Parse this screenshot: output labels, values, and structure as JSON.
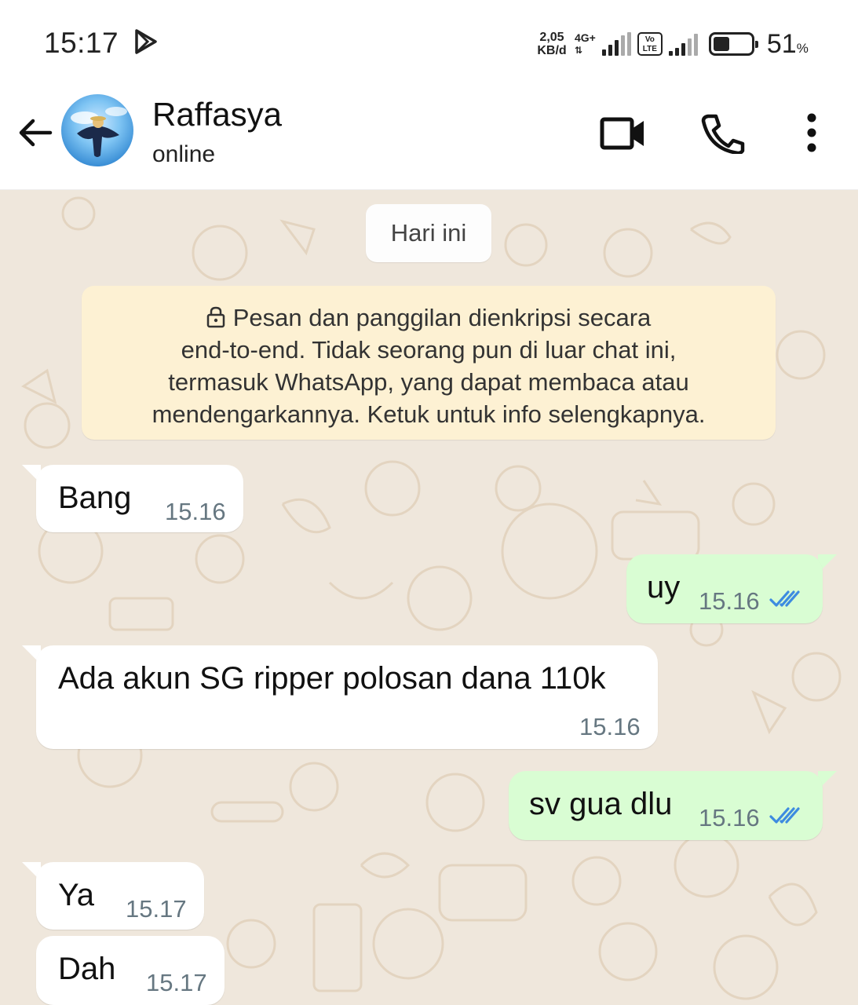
{
  "status_bar": {
    "time": "15:17",
    "speed_value": "2,05",
    "speed_unit": "KB/d",
    "network": "4G+",
    "volte": "Vo LTE",
    "battery_percent": "51",
    "battery_unit": "%",
    "battery_level": 0.51
  },
  "header": {
    "contact_name": "Raffasya",
    "contact_status": "online"
  },
  "chat": {
    "date_chip": "Hari ini",
    "encryption_lines": [
      "Pesan dan panggilan dienkripsi secara",
      "end-to-end. Tidak seorang pun di luar chat ini,",
      "termasuk WhatsApp, yang dapat membaca atau",
      "mendengarkannya. Ketuk untuk info selengkapnya."
    ],
    "messages": [
      {
        "direction": "in",
        "text": "Bang",
        "time": "15.16"
      },
      {
        "direction": "out",
        "text": "uy",
        "time": "15.16",
        "read": true
      },
      {
        "direction": "in",
        "text": "Ada akun SG ripper polosan dana 110k",
        "time": "15.16"
      },
      {
        "direction": "out",
        "text": "sv gua dlu",
        "time": "15.16",
        "read": true
      },
      {
        "direction": "in",
        "text": "Ya",
        "time": "15.17"
      },
      {
        "direction": "in",
        "text": "Dah",
        "time": "15.17"
      }
    ]
  },
  "colors": {
    "chat_bg": "#efe7dc",
    "incoming_bubble": "#ffffff",
    "outgoing_bubble": "#d9fdd3",
    "encryption_notice": "#fdf1d3",
    "read_ticks": "#53bdeb"
  }
}
